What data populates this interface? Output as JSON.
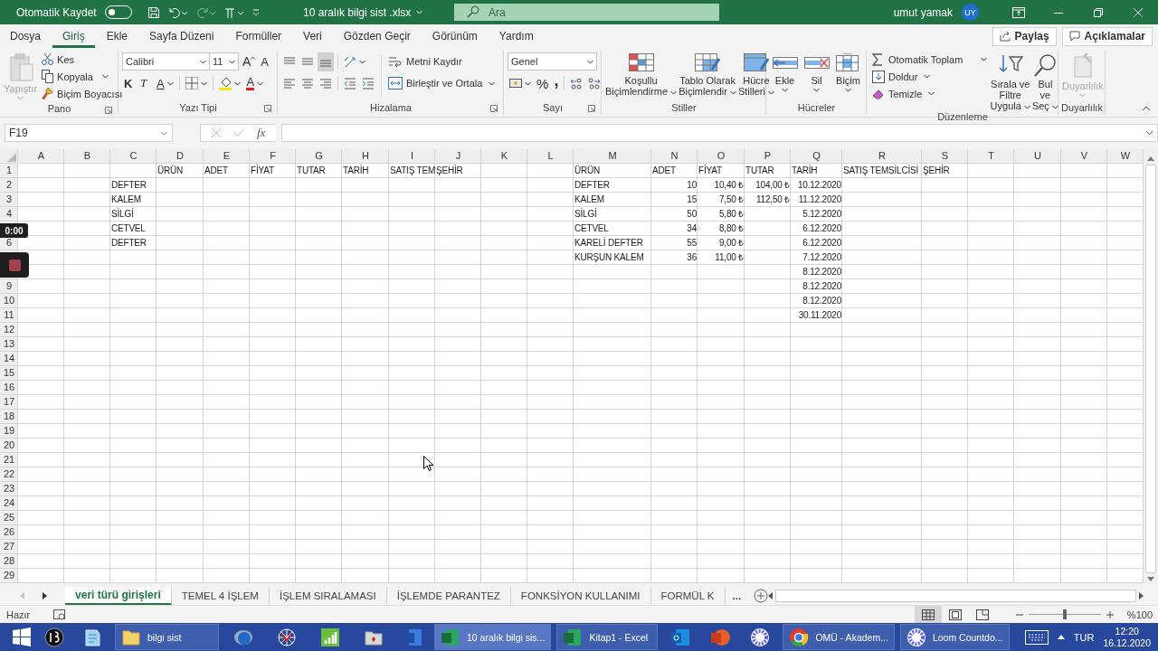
{
  "titlebar": {
    "autosave": {
      "label": "Otomatik Kaydet",
      "on": false
    },
    "filename": "10 aralık bilgi sist .xlsx",
    "search": {
      "placeholder": "Ara"
    },
    "user": {
      "name": "umut yamak",
      "initials": "UY"
    }
  },
  "menu": {
    "tabs": [
      {
        "label": "Dosya",
        "selected": false
      },
      {
        "label": "Giriş",
        "selected": true
      },
      {
        "label": "Ekle",
        "selected": false
      },
      {
        "label": "Sayfa Düzeni",
        "selected": false
      },
      {
        "label": "Formüller",
        "selected": false
      },
      {
        "label": "Veri",
        "selected": false
      },
      {
        "label": "Gözden Geçir",
        "selected": false
      },
      {
        "label": "Görünüm",
        "selected": false
      },
      {
        "label": "Yardım",
        "selected": false
      }
    ],
    "share": "Paylaş",
    "comments": "Açıklamalar"
  },
  "ribbon": {
    "groups": [
      {
        "kind": "clipboard",
        "name": "Pano",
        "launcher": true,
        "paste": {
          "label": "Yapıştır",
          "disabled": true
        },
        "buttons": [
          {
            "label": "Kes"
          },
          {
            "label": "Kopyala",
            "dropdown": true
          },
          {
            "label": "Biçim Boyacısı"
          }
        ]
      },
      {
        "kind": "font",
        "name": "Yazı Tipi",
        "launcher": true,
        "font": "Calibri",
        "size": "11",
        "grow": "A",
        "shrink": "A",
        "bold": "K",
        "italic": "T",
        "underline": "A",
        "font_color": "A"
      },
      {
        "kind": "alignment",
        "name": "Hizalama",
        "launcher": true,
        "vertical": [
          {
            "selected": false
          },
          {
            "selected": false
          },
          {
            "selected": true
          }
        ],
        "wrap": "Metni Kaydır",
        "merge": "Birleştir ve Ortala"
      },
      {
        "kind": "number",
        "name": "Sayı",
        "launcher": true,
        "format": "Genel",
        "percent": "%",
        "comma": ","
      },
      {
        "kind": "styles",
        "name": "Stiller",
        "buttons": [
          {
            "label": "Koşullu Biçimlendirme"
          },
          {
            "label": "Tablo Olarak Biçimlendir"
          },
          {
            "label": "Hücre Stilleri"
          }
        ]
      },
      {
        "kind": "cells",
        "name": "Hücreler",
        "buttons": [
          {
            "label": "Ekle"
          },
          {
            "label": "Sil"
          },
          {
            "label": "Biçim"
          }
        ]
      },
      {
        "kind": "editing",
        "name": "Düzenleme",
        "small": [
          {
            "label": "Otomatik Toplam"
          },
          {
            "label": "Doldur"
          },
          {
            "label": "Temizle"
          }
        ],
        "large": [
          {
            "label": "Sırala ve Filtre Uygula"
          },
          {
            "label": "Bul ve Seç"
          }
        ]
      },
      {
        "kind": "sensitivity",
        "name": "Duyarlılık",
        "button": {
          "label": "Duyarlılık",
          "disabled": true
        }
      }
    ]
  },
  "formula_bar": {
    "name_box": "F19",
    "function_button": "fx"
  },
  "sheet": {
    "columns": [
      "A",
      "B",
      "C",
      "D",
      "E",
      "F",
      "G",
      "H",
      "I",
      "J",
      "K",
      "L",
      "M",
      "N",
      "O",
      "P",
      "Q",
      "R",
      "S",
      "T",
      "U",
      "V",
      "W"
    ],
    "rows": [
      {
        "number": "1",
        "cells": [
          null,
          null,
          null,
          {
            "text": "ÜRÜN",
            "kind": "text"
          },
          {
            "text": "ADET",
            "kind": "text"
          },
          {
            "text": "FİYAT",
            "kind": "text"
          },
          {
            "text": "TUTAR",
            "kind": "text"
          },
          {
            "text": "TARİH",
            "kind": "text"
          },
          {
            "text": "SATIŞ TEM",
            "kind": "text"
          },
          {
            "text": "ŞEHİR",
            "kind": "text"
          },
          null,
          null,
          {
            "text": "ÜRÜN",
            "kind": "text"
          },
          {
            "text": "ADET",
            "kind": "text"
          },
          {
            "text": "FİYAT",
            "kind": "text"
          },
          {
            "text": "TUTAR",
            "kind": "text"
          },
          {
            "text": "TARİH",
            "kind": "text"
          },
          {
            "text": "SATIŞ TEMSİLCİSİ",
            "kind": "text"
          },
          {
            "text": "ŞEHİR",
            "kind": "text"
          }
        ]
      },
      {
        "number": "2",
        "cells": [
          null,
          null,
          {
            "text": "DEFTER",
            "kind": "text"
          },
          null,
          null,
          null,
          null,
          null,
          null,
          null,
          null,
          null,
          {
            "text": "DEFTER",
            "kind": "text"
          },
          {
            "text": "10",
            "kind": "number"
          },
          {
            "text": "10,40 ₺",
            "kind": "number"
          },
          {
            "text": "104,00 ₺",
            "kind": "number"
          },
          {
            "text": "10.12.2020",
            "kind": "number"
          }
        ]
      },
      {
        "number": "3",
        "cells": [
          null,
          null,
          {
            "text": "KALEM",
            "kind": "text"
          },
          null,
          null,
          null,
          null,
          null,
          null,
          null,
          null,
          null,
          {
            "text": "KALEM",
            "kind": "text"
          },
          {
            "text": "15",
            "kind": "number"
          },
          {
            "text": "7,50 ₺",
            "kind": "number"
          },
          {
            "text": "112,50 ₺",
            "kind": "number"
          },
          {
            "text": "11.12.2020",
            "kind": "number"
          }
        ]
      },
      {
        "number": "4",
        "cells": [
          null,
          null,
          {
            "text": "SİLGİ",
            "kind": "text"
          },
          null,
          null,
          null,
          null,
          null,
          null,
          null,
          null,
          null,
          {
            "text": "SİLGİ",
            "kind": "text"
          },
          {
            "text": "50",
            "kind": "number"
          },
          {
            "text": "5,80 ₺",
            "kind": "number"
          },
          null,
          {
            "text": "5.12.2020",
            "kind": "number"
          }
        ]
      },
      {
        "cells": [
          null,
          null,
          {
            "text": "CETVEL",
            "kind": "text"
          },
          null,
          null,
          null,
          null,
          null,
          null,
          null,
          null,
          null,
          {
            "text": "CETVEL",
            "kind": "text"
          },
          {
            "text": "34",
            "kind": "number"
          },
          {
            "text": "8,80 ₺",
            "kind": "number"
          },
          null,
          {
            "text": "6.12.2020",
            "kind": "number"
          }
        ]
      },
      {
        "number": "6",
        "cells": [
          null,
          null,
          {
            "text": "DEFTER",
            "kind": "text"
          },
          null,
          null,
          null,
          null,
          null,
          null,
          null,
          null,
          null,
          {
            "text": "KARELİ DEFTER",
            "kind": "text"
          },
          {
            "text": "55",
            "kind": "number"
          },
          {
            "text": "9,00 ₺",
            "kind": "number"
          },
          null,
          {
            "text": "6.12.2020",
            "kind": "number"
          }
        ]
      },
      {
        "cells": [
          null,
          null,
          null,
          null,
          null,
          null,
          null,
          null,
          null,
          null,
          null,
          null,
          {
            "text": "KURŞUN KALEM",
            "kind": "text"
          },
          {
            "text": "36",
            "kind": "number"
          },
          {
            "text": "11,00 ₺",
            "kind": "number"
          },
          null,
          {
            "text": "7.12.2020",
            "kind": "number"
          }
        ]
      },
      {
        "cells": [
          null,
          null,
          null,
          null,
          null,
          null,
          null,
          null,
          null,
          null,
          null,
          null,
          null,
          null,
          null,
          null,
          {
            "text": "8.12.2020",
            "kind": "number"
          }
        ]
      },
      {
        "number": "9",
        "cells": [
          null,
          null,
          null,
          null,
          null,
          null,
          null,
          null,
          null,
          null,
          null,
          null,
          null,
          null,
          null,
          null,
          {
            "text": "8.12.2020",
            "kind": "number"
          }
        ]
      },
      {
        "number": "10",
        "cells": [
          null,
          null,
          null,
          null,
          null,
          null,
          null,
          null,
          null,
          null,
          null,
          null,
          null,
          null,
          null,
          null,
          {
            "text": "8.12.2020",
            "kind": "number"
          }
        ]
      },
      {
        "number": "11",
        "cells": [
          null,
          null,
          null,
          null,
          null,
          null,
          null,
          null,
          null,
          null,
          null,
          null,
          null,
          null,
          null,
          null,
          {
            "text": "30.11.2020",
            "kind": "number"
          }
        ]
      },
      {
        "number": "12"
      },
      {
        "number": "13"
      },
      {
        "number": "14"
      },
      {
        "number": "15"
      },
      {
        "number": "16"
      },
      {
        "number": "17"
      },
      {
        "number": "18"
      },
      {
        "number": "19"
      },
      {
        "number": "20"
      },
      {
        "number": "21"
      },
      {
        "number": "22"
      },
      {
        "number": "23"
      },
      {
        "number": "24"
      },
      {
        "number": "25"
      },
      {
        "number": "26"
      },
      {
        "number": "27"
      },
      {
        "number": "28"
      },
      {
        "number": "29"
      }
    ]
  },
  "recorder": {
    "time": "0:00"
  },
  "sheet_tabs": {
    "tabs": [
      {
        "label": "veri türü girişleri",
        "selected": true
      },
      {
        "label": "TEMEL 4 İŞLEM",
        "selected": false
      },
      {
        "label": "İŞLEM SIRALAMASI",
        "selected": false
      },
      {
        "label": "İŞLEMDE PARANTEZ",
        "selected": false
      },
      {
        "label": "FONKSİYON KULLANIMI",
        "selected": false
      },
      {
        "label": "FORMÜL K",
        "selected": false
      }
    ],
    "more": "..."
  },
  "status_bar": {
    "status": "Hazır",
    "views": [
      {
        "selected": true
      },
      {
        "selected": false
      },
      {
        "selected": false
      }
    ],
    "zoom": {
      "level": 0.5,
      "reading": "%100"
    }
  },
  "taskbar": {
    "items": [
      {
        "kind": "start"
      },
      {
        "kind": "icon"
      },
      {
        "kind": "icon"
      },
      {
        "kind": "window",
        "label": "bilgi sist",
        "selected": false
      },
      {
        "kind": "icon"
      },
      {
        "kind": "icon"
      },
      {
        "kind": "icon"
      },
      {
        "kind": "icon"
      },
      {
        "kind": "icon"
      },
      {
        "kind": "window",
        "label": "10 aralık bilgi sis...",
        "selected": true
      },
      {
        "kind": "window",
        "label": "Kitap1 - Excel",
        "selected": false
      },
      {
        "kind": "icon"
      },
      {
        "kind": "icon"
      },
      {
        "kind": "icon"
      },
      {
        "kind": "window",
        "label": "OMÜ - Akadem...",
        "selected": false
      },
      {
        "kind": "window",
        "label": "Loom Countdo...",
        "selected": false
      }
    ],
    "language": "TUR",
    "time": "12:20",
    "date": "16.12.2020"
  }
}
